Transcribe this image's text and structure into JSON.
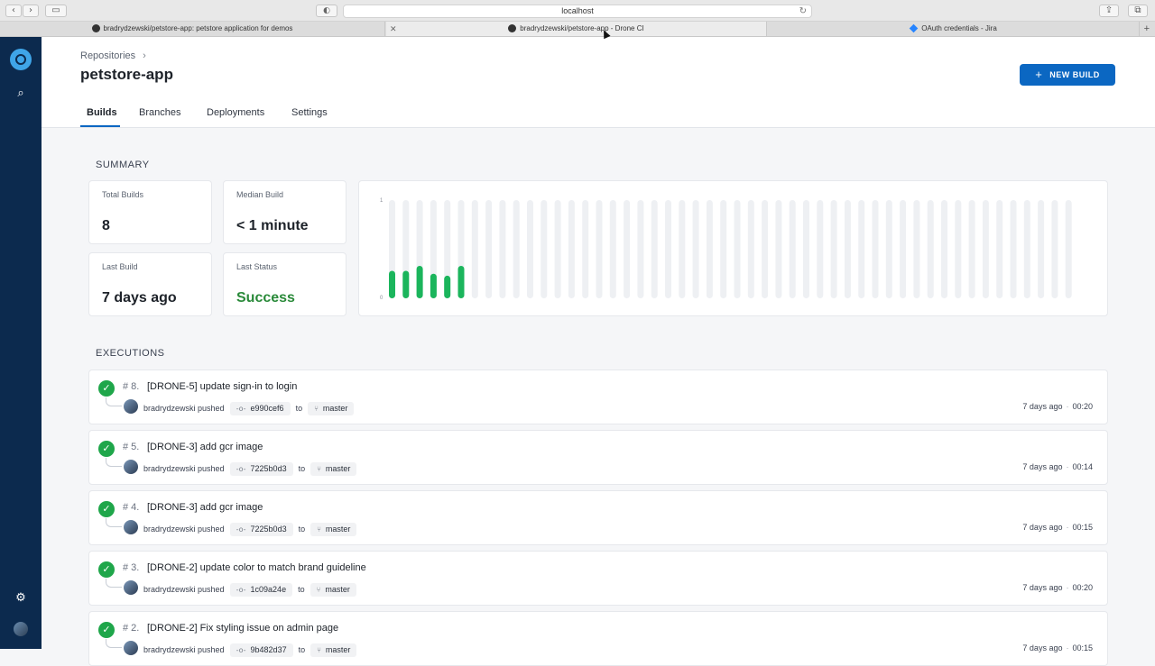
{
  "browser": {
    "url": "localhost",
    "tabs": [
      {
        "label": "bradrydzewski/petstore-app: petstore application for demos"
      },
      {
        "label": "bradrydzewski/petstore-app - Drone CI",
        "active": true
      },
      {
        "label": "OAuth credentials - Jira"
      }
    ]
  },
  "sidebar": {
    "icons": [
      "drone-logo-icon",
      "search-icon",
      "settings-sliders-icon",
      "user-avatar"
    ]
  },
  "header": {
    "breadcrumb": "Repositories",
    "title": "petstore-app",
    "new_build": "NEW BUILD"
  },
  "nav": {
    "tabs": [
      "Builds",
      "Branches",
      "Deployments",
      "Settings"
    ],
    "active": "Builds"
  },
  "summary": {
    "label": "SUMMARY",
    "total_builds_label": "Total Builds",
    "total_builds": "8",
    "median_build_label": "Median Build",
    "median_build": "< 1 minute",
    "last_build_label": "Last Build",
    "last_build": "7 days ago",
    "last_status_label": "Last Status",
    "last_status": "Success"
  },
  "chart_data": {
    "type": "bar",
    "ylim": [
      0,
      1
    ],
    "ytick_labels": [
      "1",
      "0"
    ],
    "values": [
      0.28,
      0.28,
      0.33,
      0.25,
      0.23,
      0.33,
      0,
      0,
      0,
      0,
      0,
      0,
      0,
      0,
      0,
      0,
      0,
      0,
      0,
      0,
      0,
      0,
      0,
      0,
      0,
      0,
      0,
      0,
      0,
      0,
      0,
      0,
      0,
      0,
      0,
      0,
      0,
      0,
      0,
      0,
      0,
      0,
      0,
      0,
      0,
      0,
      0,
      0,
      0,
      0
    ],
    "colors": {
      "bar": "#1bb55c",
      "track": "#eef0f3"
    }
  },
  "executions": {
    "label": "EXECUTIONS",
    "items": [
      {
        "num": "# 8.",
        "title": "[DRONE-5] update sign-in to login",
        "author": "bradrydzewski pushed",
        "commit": "e990cef6",
        "to": "to",
        "branch": "master",
        "ago": "7 days ago",
        "duration": "00:20"
      },
      {
        "num": "# 5.",
        "title": "[DRONE-3] add gcr image",
        "author": "bradrydzewski pushed",
        "commit": "7225b0d3",
        "to": "to",
        "branch": "master",
        "ago": "7 days ago",
        "duration": "00:14"
      },
      {
        "num": "# 4.",
        "title": "[DRONE-3] add gcr image",
        "author": "bradrydzewski pushed",
        "commit": "7225b0d3",
        "to": "to",
        "branch": "master",
        "ago": "7 days ago",
        "duration": "00:15"
      },
      {
        "num": "# 3.",
        "title": "[DRONE-2] update color to match brand guideline",
        "author": "bradrydzewski pushed",
        "commit": "1c09a24e",
        "to": "to",
        "branch": "master",
        "ago": "7 days ago",
        "duration": "00:20"
      },
      {
        "num": "# 2.",
        "title": "[DRONE-2] Fix styling issue on admin page",
        "author": "bradrydzewski pushed",
        "commit": "9b482d37",
        "to": "to",
        "branch": "master",
        "ago": "7 days ago",
        "duration": "00:15"
      }
    ]
  }
}
